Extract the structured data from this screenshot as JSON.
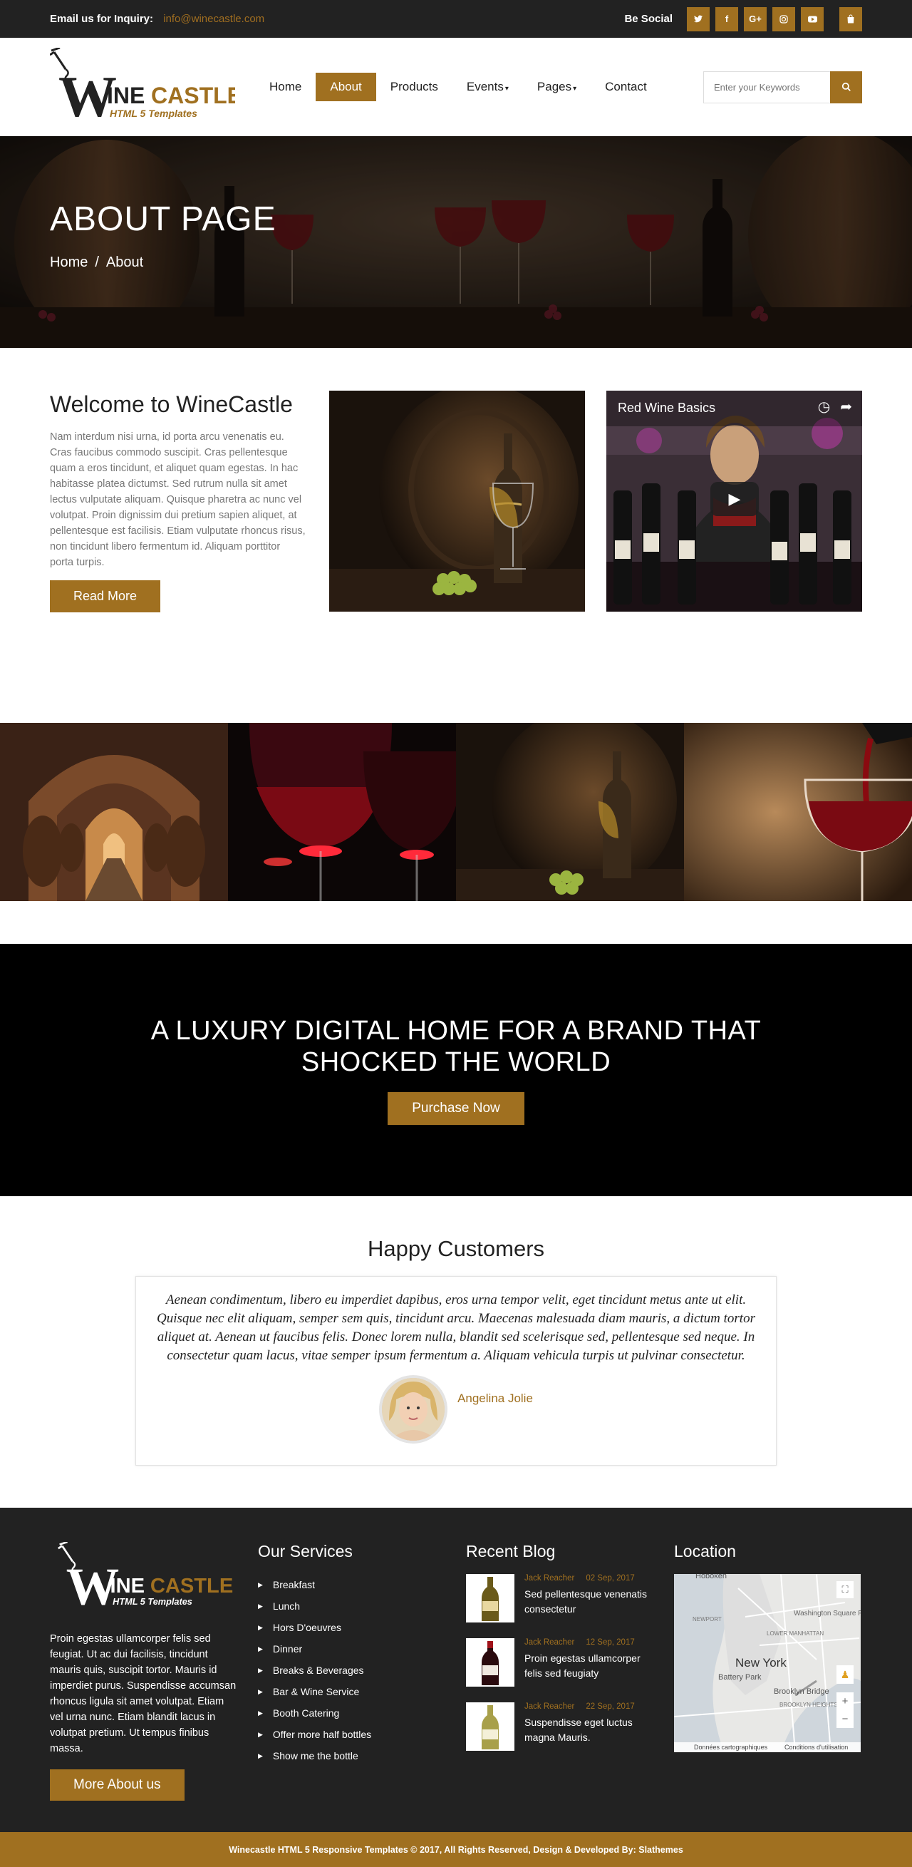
{
  "topbar": {
    "inquiry_label": "Email us for Inquiry:",
    "email": "info@winecastle.com",
    "social_label": "Be Social",
    "social": [
      "twitter-icon",
      "facebook-icon",
      "google-plus-icon",
      "instagram-icon",
      "youtube-icon"
    ],
    "cart_icon": "shopping-bag-icon"
  },
  "header": {
    "logo_main_w": "W",
    "logo_main_rest": "INE",
    "logo_castle": "CASTLE",
    "logo_sub": "HTML 5 Templates",
    "nav": [
      {
        "label": "Home",
        "active": false
      },
      {
        "label": "About",
        "active": true
      },
      {
        "label": "Products",
        "active": false
      },
      {
        "label": "Events",
        "active": false,
        "dropdown": true
      },
      {
        "label": "Pages",
        "active": false,
        "dropdown": true
      },
      {
        "label": "Contact",
        "active": false
      }
    ],
    "search_placeholder": "Enter your Keywords"
  },
  "banner": {
    "title": "ABOUT PAGE",
    "crumb_home": "Home",
    "crumb_sep": "/",
    "crumb_current": "About"
  },
  "welcome": {
    "title": "Welcome to WineCastle",
    "body": "Nam interdum nisi urna, id porta arcu venenatis eu. Cras faucibus commodo suscipit. Cras pellentesque quam a eros tincidunt, et aliquet quam egestas. In hac habitasse platea dictumst. Sed rutrum nulla sit amet lectus vulputate aliquam. Quisque pharetra ac nunc vel volutpat. Proin dignissim dui pretium sapien aliquet, at pellentesque est facilisis. Etiam vulputate rhoncus risus, non tincidunt libero fermentum id. Aliquam porttitor porta turpis.",
    "button": "Read More",
    "video_title": "Red Wine Basics"
  },
  "cta": {
    "title_line1": "A LUXURY DIGITAL HOME FOR A BRAND THAT",
    "title_line2": "SHOCKED THE WORLD",
    "button": "Purchase Now"
  },
  "testimonials": {
    "title": "Happy Customers",
    "quote": "Aenean condimentum, libero eu imperdiet dapibus, eros urna tempor velit, eget tincidunt metus ante ut elit. Quisque nec elit aliquam, semper sem quis, tincidunt arcu. Maecenas malesuada diam mauris, a dictum tortor aliquet at. Aenean ut faucibus felis. Donec lorem nulla, blandit sed scelerisque sed, pellentesque sed neque. In consectetur quam lacus, vitae semper ipsum fermentum a. Aliquam vehicula turpis ut pulvinar consectetur.",
    "author": "Angelina Jolie"
  },
  "footer": {
    "about_text": "Proin egestas ullamcorper felis sed feugiat. Ut ac dui facilisis, tincidunt mauris quis, suscipit tortor. Mauris id imperdiet purus. Suspendisse accumsan rhoncus ligula sit amet volutpat. Etiam vel urna nunc. Etiam blandit lacus in volutpat pretium. Ut tempus finibus massa.",
    "about_button": "More About us",
    "services_title": "Our Services",
    "services": [
      "Breakfast",
      "Lunch",
      "Hors D'oeuvres",
      "Dinner",
      "Breaks & Beverages",
      "Bar & Wine Service",
      "Booth Catering",
      "Offer more half bottles",
      "Show me the bottle"
    ],
    "blog_title": "Recent Blog",
    "blog": [
      {
        "author": "Jack Reacher",
        "date": "02 Sep, 2017",
        "title": "Sed pellentesque venenatis consectetur"
      },
      {
        "author": "Jack Reacher",
        "date": "12 Sep, 2017",
        "title": "Proin egestas ullamcorper felis sed feugiaty"
      },
      {
        "author": "Jack Reacher",
        "date": "22 Sep, 2017",
        "title": "Suspendisse eget luctus magna Mauris."
      }
    ],
    "location_title": "Location",
    "map_labels": {
      "hoboken": "Hoboken",
      "newport": "NEWPORT",
      "washington_sq": "Washington Square Park",
      "lower_manhattan": "LOWER MANHATTAN",
      "new_york": "New York",
      "battery_park": "Battery Park",
      "brooklyn_bridge": "Brooklyn Bridge",
      "brooklyn_heights": "BROOKLYN HEIGHTS",
      "map_data": "Données cartographiques",
      "terms": "Conditions d'utilisation"
    }
  },
  "copyright": "Winecastle HTML 5 Responsive Templates © 2017, All Rights Reserved, Design & Developed By: Slathemes",
  "colors": {
    "accent": "#a07020",
    "dark": "#222222",
    "black": "#000000"
  }
}
